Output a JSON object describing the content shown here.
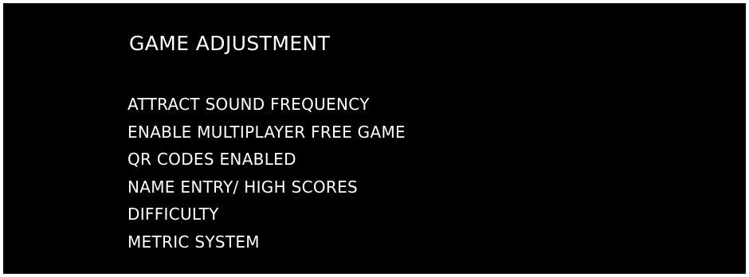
{
  "screen": {
    "title": "GAME ADJUSTMENT",
    "menu_items": [
      "ATTRACT SOUND FREQUENCY",
      "ENABLE MULTIPLAYER FREE GAME",
      "QR CODES ENABLED",
      "NAME ENTRY/ HIGH SCORES",
      "DIFFICULTY",
      "METRIC SYSTEM"
    ]
  },
  "colors": {
    "background": "#000000",
    "text": "#ffffff",
    "frame": "#ffffff"
  }
}
